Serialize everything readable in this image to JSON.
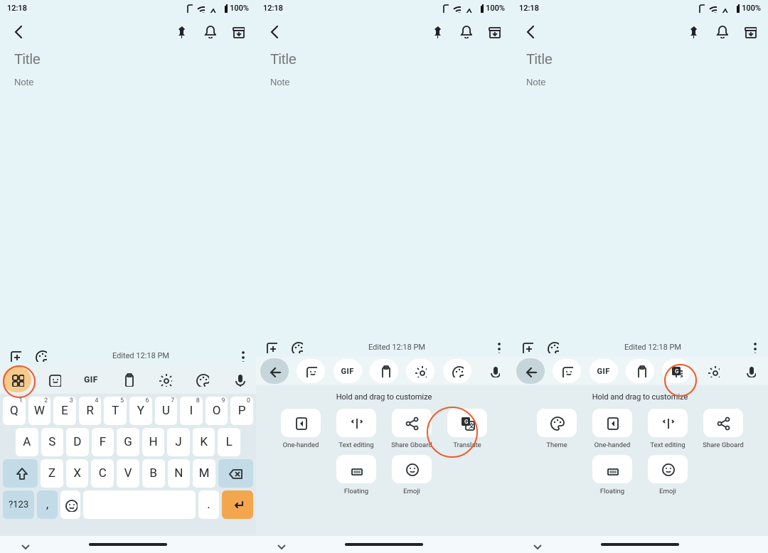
{
  "status": {
    "time": "12:18",
    "battery": "100%"
  },
  "app": {
    "title_placeholder": "Title",
    "note_placeholder": "Note",
    "edited": "Edited 12:18 PM"
  },
  "strip": {
    "gif": "GIF"
  },
  "keys": {
    "row1": [
      "Q",
      "W",
      "E",
      "R",
      "T",
      "Y",
      "U",
      "I",
      "O",
      "P"
    ],
    "row1sup": [
      "1",
      "2",
      "3",
      "4",
      "5",
      "6",
      "7",
      "8",
      "9",
      "0"
    ],
    "row2": [
      "A",
      "S",
      "D",
      "F",
      "G",
      "H",
      "J",
      "K",
      "L"
    ],
    "row3": [
      "Z",
      "X",
      "C",
      "V",
      "B",
      "N",
      "M"
    ],
    "sym": "?123",
    "comma": ",",
    "period": "."
  },
  "feature_hint": "Hold and drag to customize",
  "features_pane2": [
    {
      "id": "one_handed",
      "label": "One-handed"
    },
    {
      "id": "text_editing",
      "label": "Text editing"
    },
    {
      "id": "share",
      "label": "Share Gboard"
    },
    {
      "id": "translate",
      "label": "Translate"
    },
    {
      "id": "floating",
      "label": "Floating"
    },
    {
      "id": "emoji",
      "label": "Emoji"
    }
  ],
  "features_pane3": [
    {
      "id": "theme",
      "label": "Theme"
    },
    {
      "id": "one_handed",
      "label": "One-handed"
    },
    {
      "id": "text_editing",
      "label": "Text editing"
    },
    {
      "id": "share",
      "label": "Share Gboard"
    },
    {
      "id": "floating",
      "label": "Floating"
    },
    {
      "id": "emoji",
      "label": "Emoji"
    }
  ],
  "annotations": {
    "pane1_circle": "apps-menu-icon",
    "pane2_circle": "translate-feature",
    "pane3_circle": "translate-toolbar-icon"
  }
}
